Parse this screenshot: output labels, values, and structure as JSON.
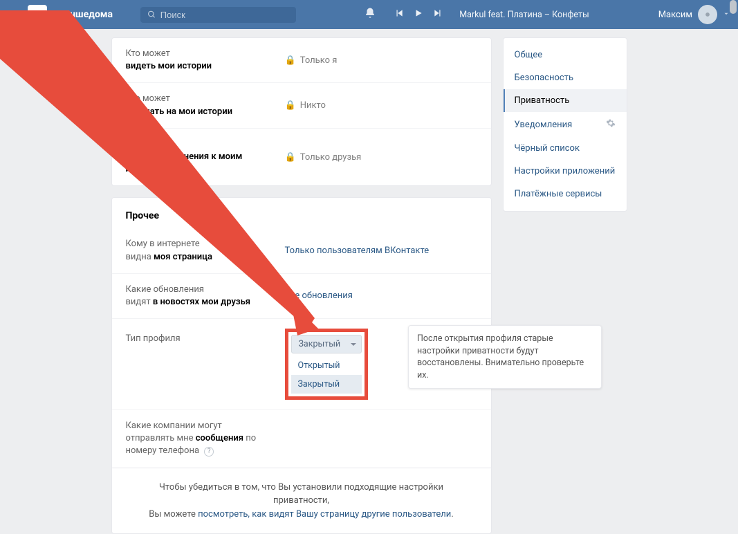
{
  "header": {
    "hashtag": "#лучшедома",
    "search_placeholder": "Поиск",
    "track": "Markul feat. Платина – Конфеты",
    "user": "Максим"
  },
  "rows": {
    "stories_view": {
      "l1": "Кто может",
      "l2": "видеть мои истории",
      "val": "Только я"
    },
    "stories_reply": {
      "l1": "Кто может",
      "l2": "отвечать на мои истории",
      "val": "Никто"
    },
    "stories_opinions": {
      "l1": "Кто может",
      "l2": "отправлять мнения к моим историям",
      "val": "Только друзья"
    },
    "section_other": "Прочее",
    "page_visible": {
      "l1": "Кому в интернете",
      "l2": "видна моя страница",
      "val": "Только пользователям ВКонтакте"
    },
    "updates": {
      "l1": "Какие обновления",
      "l2": "видят в новостях мои друзья",
      "val": "Все обновления"
    },
    "profile_type": {
      "l1": "Тип профиля",
      "selected": "Закрытый",
      "opt_open": "Открытый",
      "opt_closed": "Закрытый"
    },
    "companies": {
      "l1": "Какие компании могут",
      "l2a": "отправлять мне ",
      "l2b": "сообщения",
      "l2c": " по номеру телефона"
    }
  },
  "tooltip": "После открытия профиля старые настройки приватности будут восстановлены. Внимательно проверьте их.",
  "footer": {
    "t1": "Чтобы убедиться в том, что Вы установили подходящие настройки приватности,",
    "t2": "Вы можете ",
    "link": "посмотреть, как видят Вашу страницу другие пользователи"
  },
  "sidebar": {
    "items": [
      "Общее",
      "Безопасность",
      "Приватность",
      "Уведомления",
      "Чёрный список",
      "Настройки приложений",
      "Платёжные сервисы"
    ]
  }
}
